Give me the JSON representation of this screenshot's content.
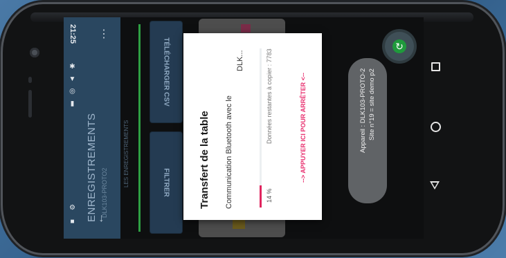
{
  "status_bar": {
    "time": "21:25",
    "icons": "✱ ▼ ◎ ▮",
    "left_icons": "⚙ ■"
  },
  "app_bar": {
    "title": "ENREGISTREMENTS",
    "subtitle": "DLK103-PROTO2",
    "back_icon": "arrow-back-icon",
    "more_icon": "more-vert-icon"
  },
  "list_header": "LES ENREGISTREMENTS",
  "buttons": {
    "download_csv": "TÉLÉCHARGER CSV",
    "filter": "FILTRER"
  },
  "dialog": {
    "title": "Transfert de la table",
    "message_line1": "Communication Bluetooth avec le",
    "message_line2": "DLK...",
    "progress_percent": "14 %",
    "progress_value": 14,
    "remaining_label": "Données restantes à copier : 7783",
    "stop_action": "--> APPUYER ICI POUR ARRÊTER <--",
    "accent_color": "#e0245e"
  },
  "toast": {
    "line1": "Appareil : DLK103-PROTO-2",
    "line2": "Site n°19 = site demo p2"
  },
  "nav": {
    "recent_icon": "recent-apps-icon",
    "home_icon": "home-icon",
    "back_icon": "back-triangle-icon"
  },
  "colors": {
    "app_bar": "#2a4760",
    "indicator": "#2ea043"
  }
}
